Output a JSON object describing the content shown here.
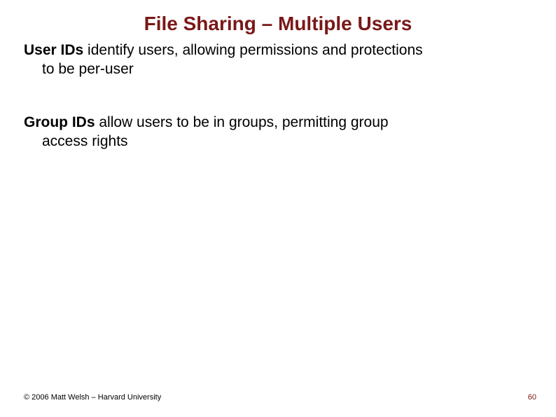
{
  "title": "File Sharing – Multiple Users",
  "bullets": [
    {
      "term": "User IDs",
      "rest_line1": " identify users, allowing permissions and protections",
      "line2": "to be per-user"
    },
    {
      "term": "Group IDs",
      "rest_line1": " allow users to be in groups, permitting group",
      "line2": "access rights"
    }
  ],
  "footer": {
    "copyright": "© 2006 Matt Welsh – Harvard University",
    "page_number": "60"
  }
}
